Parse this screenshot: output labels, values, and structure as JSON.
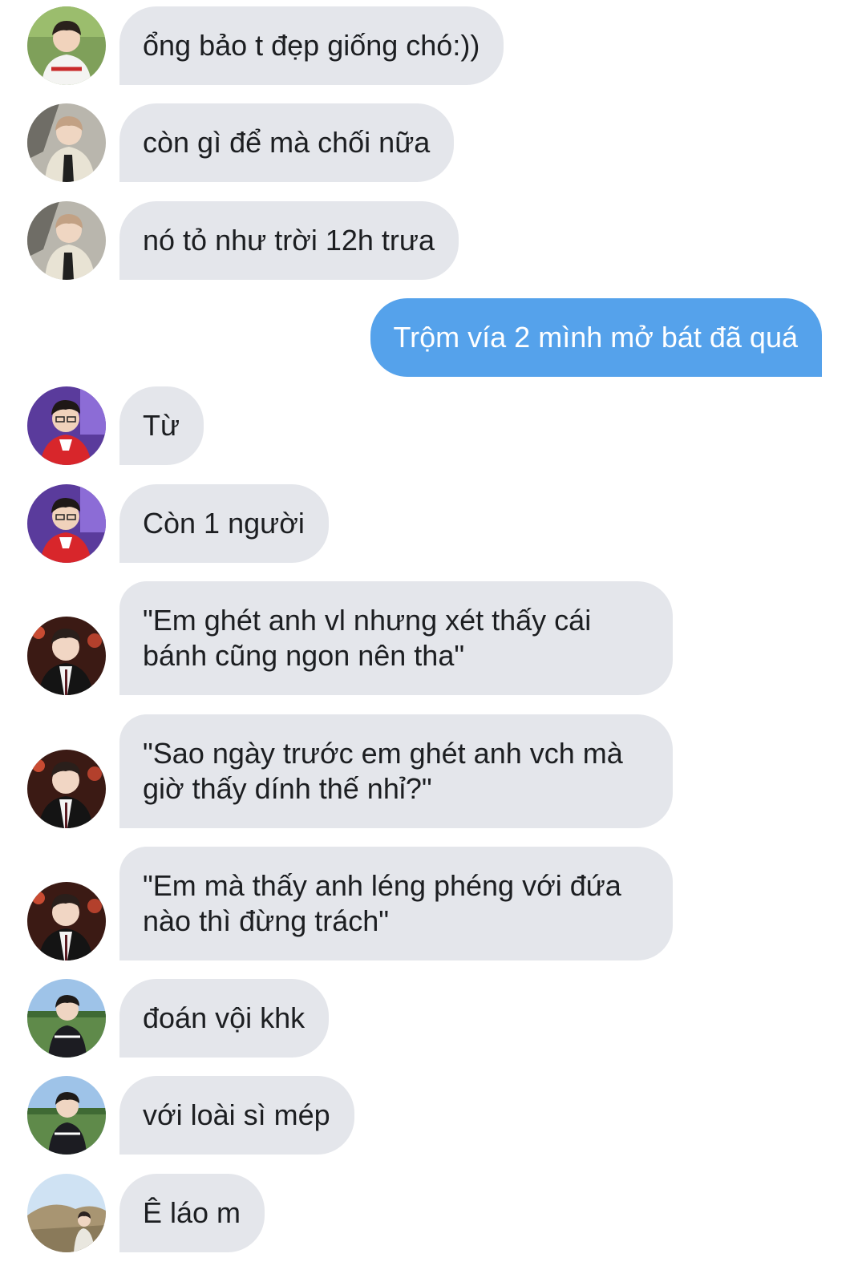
{
  "colors": {
    "incoming_bubble": "#e4e6eb",
    "outgoing_bubble": "#55a2eb",
    "incoming_text": "#1c1e21",
    "outgoing_text": "#ffffff"
  },
  "messages": [
    {
      "direction": "incoming",
      "text": "ổng bảo t đẹp giống chó:))"
    },
    {
      "direction": "incoming",
      "text": "còn gì để mà chối nữa"
    },
    {
      "direction": "incoming",
      "text": "nó tỏ như trời 12h trưa"
    },
    {
      "direction": "outgoing",
      "text": "Trộm vía 2 mình mở bát đã quá"
    },
    {
      "direction": "incoming",
      "text": "Từ"
    },
    {
      "direction": "incoming",
      "text": "Còn 1 người"
    },
    {
      "direction": "incoming",
      "text": "\"Em ghét anh vl nhưng xét thấy cái bánh cũng ngon nên tha\""
    },
    {
      "direction": "incoming",
      "text": "\"Sao ngày trước em ghét anh vch mà giờ thấy dính thế nhỉ?\""
    },
    {
      "direction": "incoming",
      "text": "\"Em mà thấy anh léng phéng với đứa nào thì đừng trách\""
    },
    {
      "direction": "incoming",
      "text": "đoán vội khk"
    },
    {
      "direction": "incoming",
      "text": "với loài sì mép"
    },
    {
      "direction": "incoming",
      "text": "Ê láo m"
    }
  ]
}
